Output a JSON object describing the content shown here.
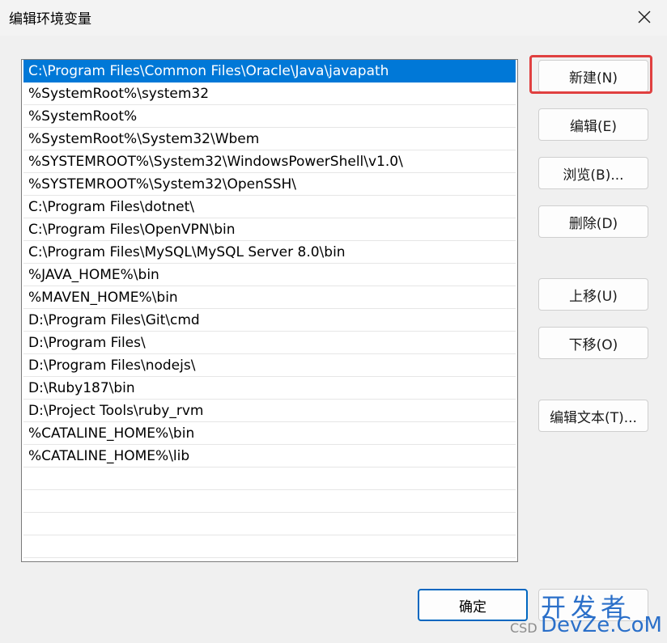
{
  "window": {
    "title": "编辑环境变量"
  },
  "list": {
    "items": [
      "C:\\Program Files\\Common Files\\Oracle\\Java\\javapath",
      "%SystemRoot%\\system32",
      "%SystemRoot%",
      "%SystemRoot%\\System32\\Wbem",
      "%SYSTEMROOT%\\System32\\WindowsPowerShell\\v1.0\\",
      "%SYSTEMROOT%\\System32\\OpenSSH\\",
      "C:\\Program Files\\dotnet\\",
      "C:\\Program Files\\OpenVPN\\bin",
      "C:\\Program Files\\MySQL\\MySQL Server 8.0\\bin",
      "%JAVA_HOME%\\bin",
      "%MAVEN_HOME%\\bin",
      "D:\\Program Files\\Git\\cmd",
      "D:\\Program Files\\",
      "D:\\Program Files\\nodejs\\",
      "D:\\Ruby187\\bin",
      "D:\\Project Tools\\ruby_rvm",
      "%CATALINE_HOME%\\bin",
      "%CATALINE_HOME%\\lib",
      "",
      "",
      "",
      ""
    ]
  },
  "buttons": {
    "new": "新建(N)",
    "edit": "编辑(E)",
    "browse": "浏览(B)...",
    "delete": "删除(D)",
    "move_up": "上移(U)",
    "move_down": "下移(O)",
    "edit_text": "编辑文本(T)...",
    "ok": "确定"
  },
  "watermark": {
    "main": "开发者",
    "sub": "DevZe.CoM",
    "prefix": "CSD"
  },
  "colors": {
    "selection": "#0078d7",
    "highlight_frame": "#e04040",
    "watermark": "#2a6fc9"
  }
}
